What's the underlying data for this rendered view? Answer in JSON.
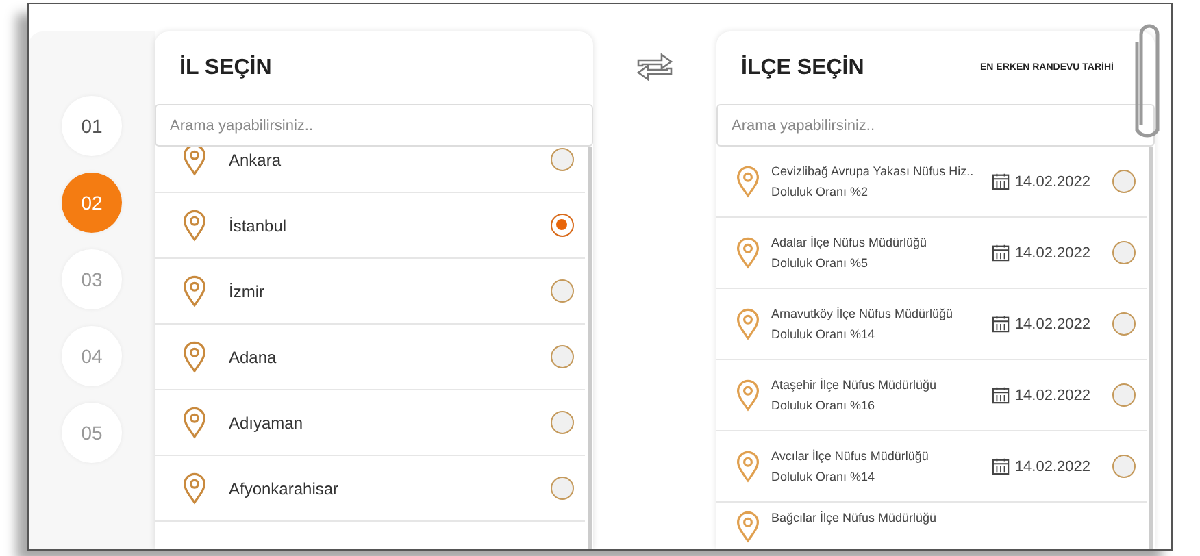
{
  "steps": [
    {
      "label": "01",
      "selected": false
    },
    {
      "label": "02",
      "selected": true
    },
    {
      "label": "03",
      "selected": false
    },
    {
      "label": "04",
      "selected": false
    },
    {
      "label": "05",
      "selected": false
    }
  ],
  "province_panel": {
    "title": "İL SEÇİN",
    "search": {
      "placeholder": "Arama yapabilirsiniz.."
    },
    "items": [
      {
        "name": "Ankara",
        "selected": false
      },
      {
        "name": "İstanbul",
        "selected": true
      },
      {
        "name": "İzmir",
        "selected": false
      },
      {
        "name": "Adana",
        "selected": false
      },
      {
        "name": "Adıyaman",
        "selected": false
      },
      {
        "name": "Afyonkarahisar",
        "selected": false
      }
    ]
  },
  "district_panel": {
    "title": "İLÇE SEÇİN",
    "column_label": "EN ERKEN RANDEVU TARİHİ",
    "search": {
      "placeholder": "Arama yapabilirsiniz.."
    },
    "items": [
      {
        "name": "Cevizlibağ Avrupa Yakası Nüfus Hiz..",
        "occupancy": "Doluluk Oranı %2",
        "date": "14.02.2022",
        "selected": false
      },
      {
        "name": "Adalar İlçe Nüfus Müdürlüğü",
        "occupancy": "Doluluk Oranı %5",
        "date": "14.02.2022",
        "selected": false
      },
      {
        "name": "Arnavutköy İlçe Nüfus Müdürlüğü",
        "occupancy": "Doluluk Oranı %14",
        "date": "14.02.2022",
        "selected": false
      },
      {
        "name": "Ataşehir İlçe Nüfus Müdürlüğü",
        "occupancy": "Doluluk Oranı %16",
        "date": "14.02.2022",
        "selected": false
      },
      {
        "name": "Avcılar İlçe Nüfus Müdürlüğü",
        "occupancy": "Doluluk Oranı %14",
        "date": "14.02.2022",
        "selected": false
      },
      {
        "name": "Bağcılar İlçe Nüfus Müdürlüğü"
      }
    ]
  }
}
